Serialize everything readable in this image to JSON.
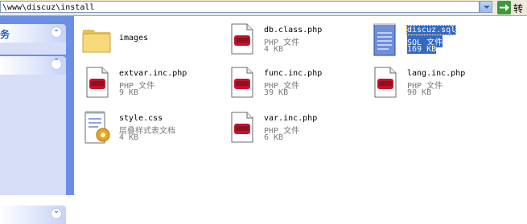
{
  "address": {
    "path": "\\www\\discuz\\install",
    "go_label": "转"
  },
  "taskpane": {
    "panel1_title": "务"
  },
  "files": [
    {
      "name": "images",
      "type": "",
      "size": "",
      "icon": "folder-icon"
    },
    {
      "name": "db.class.php",
      "type": "PHP 文件",
      "size": "4 KB",
      "icon": "php-file-icon"
    },
    {
      "name": "discuz.sql",
      "type": "SQL 文件",
      "size": "169 KB",
      "icon": "sql-file-icon",
      "selected": true
    },
    {
      "name": "extvar.inc.php",
      "type": "PHP 文件",
      "size": "9 KB",
      "icon": "php-file-icon"
    },
    {
      "name": "func.inc.php",
      "type": "PHP 文件",
      "size": "39 KB",
      "icon": "php-file-icon"
    },
    {
      "name": "lang.inc.php",
      "type": "PHP 文件",
      "size": "90 KB",
      "icon": "php-file-icon"
    },
    {
      "name": "style.css",
      "type": "层叠样式表文档",
      "size": "4 KB",
      "icon": "css-file-icon"
    },
    {
      "name": "var.inc.php",
      "type": "PHP 文件",
      "size": "6 KB",
      "icon": "php-file-icon"
    }
  ]
}
